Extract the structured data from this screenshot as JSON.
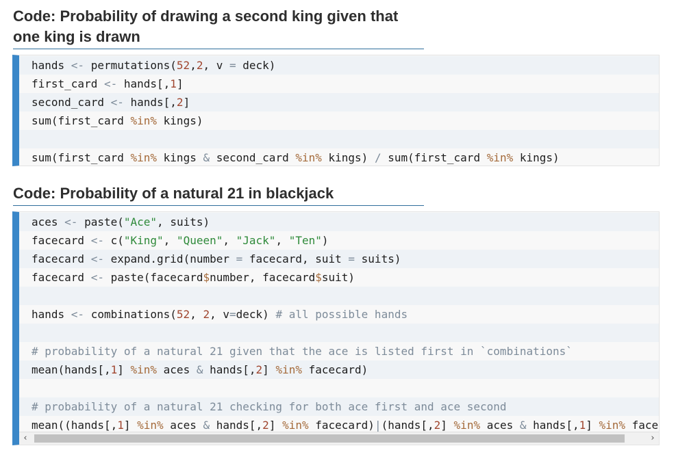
{
  "sections": [
    {
      "heading": "Code: Probability of drawing a second king given that one king is drawn",
      "lines": [
        [
          [
            "hands ",
            "plain"
          ],
          [
            "<-",
            "op"
          ],
          [
            " permutations(",
            "plain"
          ],
          [
            "52",
            "num"
          ],
          [
            ",",
            "plain"
          ],
          [
            "2",
            "num"
          ],
          [
            ", v ",
            "plain"
          ],
          [
            "=",
            "op"
          ],
          [
            " deck)",
            "plain"
          ]
        ],
        [
          [
            "first_card ",
            "plain"
          ],
          [
            "<-",
            "op"
          ],
          [
            " hands[,",
            "plain"
          ],
          [
            "1",
            "num"
          ],
          [
            "]",
            "plain"
          ]
        ],
        [
          [
            "second_card ",
            "plain"
          ],
          [
            "<-",
            "op"
          ],
          [
            " hands[,",
            "plain"
          ],
          [
            "2",
            "num"
          ],
          [
            "]",
            "plain"
          ]
        ],
        [
          [
            "sum(first_card ",
            "plain"
          ],
          [
            "%in%",
            "pct"
          ],
          [
            " kings)",
            "plain"
          ]
        ],
        [
          [
            "",
            "plain"
          ]
        ],
        [
          [
            "sum(first_card ",
            "plain"
          ],
          [
            "%in%",
            "pct"
          ],
          [
            " kings ",
            "plain"
          ],
          [
            "&",
            "op"
          ],
          [
            " second_card ",
            "plain"
          ],
          [
            "%in%",
            "pct"
          ],
          [
            " kings) ",
            "plain"
          ],
          [
            "/",
            "op"
          ],
          [
            " sum(first_card ",
            "plain"
          ],
          [
            "%in%",
            "pct"
          ],
          [
            " kings)",
            "plain"
          ]
        ]
      ]
    },
    {
      "heading": "Code: Probability of a natural 21 in blackjack",
      "lines": [
        [
          [
            "aces ",
            "plain"
          ],
          [
            "<-",
            "op"
          ],
          [
            " paste(",
            "plain"
          ],
          [
            "\"Ace\"",
            "str"
          ],
          [
            ", suits)",
            "plain"
          ]
        ],
        [
          [
            "facecard ",
            "plain"
          ],
          [
            "<-",
            "op"
          ],
          [
            " c(",
            "plain"
          ],
          [
            "\"King\"",
            "str"
          ],
          [
            ", ",
            "plain"
          ],
          [
            "\"Queen\"",
            "str"
          ],
          [
            ", ",
            "plain"
          ],
          [
            "\"Jack\"",
            "str"
          ],
          [
            ", ",
            "plain"
          ],
          [
            "\"Ten\"",
            "str"
          ],
          [
            ")",
            "plain"
          ]
        ],
        [
          [
            "facecard ",
            "plain"
          ],
          [
            "<-",
            "op"
          ],
          [
            " expand.grid(number ",
            "plain"
          ],
          [
            "=",
            "op"
          ],
          [
            " facecard, suit ",
            "plain"
          ],
          [
            "=",
            "op"
          ],
          [
            " suits)",
            "plain"
          ]
        ],
        [
          [
            "facecard ",
            "plain"
          ],
          [
            "<-",
            "op"
          ],
          [
            " paste(facecard",
            "plain"
          ],
          [
            "$",
            "pct"
          ],
          [
            "number, facecard",
            "plain"
          ],
          [
            "$",
            "pct"
          ],
          [
            "suit)",
            "plain"
          ]
        ],
        [
          [
            "",
            "plain"
          ]
        ],
        [
          [
            "hands ",
            "plain"
          ],
          [
            "<-",
            "op"
          ],
          [
            " combinations(",
            "plain"
          ],
          [
            "52",
            "num"
          ],
          [
            ", ",
            "plain"
          ],
          [
            "2",
            "num"
          ],
          [
            ", v",
            "plain"
          ],
          [
            "=",
            "op"
          ],
          [
            "deck) ",
            "plain"
          ],
          [
            "# all possible hands",
            "cmt"
          ]
        ],
        [
          [
            "",
            "plain"
          ]
        ],
        [
          [
            "# probability of a natural 21 given that the ace is listed first in `combinations`",
            "cmt"
          ]
        ],
        [
          [
            "mean(hands[,",
            "plain"
          ],
          [
            "1",
            "num"
          ],
          [
            "] ",
            "plain"
          ],
          [
            "%in%",
            "pct"
          ],
          [
            " aces ",
            "plain"
          ],
          [
            "&",
            "op"
          ],
          [
            " hands[,",
            "plain"
          ],
          [
            "2",
            "num"
          ],
          [
            "] ",
            "plain"
          ],
          [
            "%in%",
            "pct"
          ],
          [
            " facecard)",
            "plain"
          ]
        ],
        [
          [
            "",
            "plain"
          ]
        ],
        [
          [
            "# probability of a natural 21 checking for both ace first and ace second",
            "cmt"
          ]
        ],
        [
          [
            "mean((hands[,",
            "plain"
          ],
          [
            "1",
            "num"
          ],
          [
            "] ",
            "plain"
          ],
          [
            "%in%",
            "pct"
          ],
          [
            " aces ",
            "plain"
          ],
          [
            "&",
            "op"
          ],
          [
            " hands[,",
            "plain"
          ],
          [
            "2",
            "num"
          ],
          [
            "] ",
            "plain"
          ],
          [
            "%in%",
            "pct"
          ],
          [
            " facecard)",
            "plain"
          ],
          [
            "|",
            "op"
          ],
          [
            "(hands[,",
            "plain"
          ],
          [
            "2",
            "num"
          ],
          [
            "] ",
            "plain"
          ],
          [
            "%in%",
            "pct"
          ],
          [
            " aces ",
            "plain"
          ],
          [
            "&",
            "op"
          ],
          [
            " hands[,",
            "plain"
          ],
          [
            "1",
            "num"
          ],
          [
            "] ",
            "plain"
          ],
          [
            "%in%",
            "pct"
          ],
          [
            " facecard))",
            "plain"
          ]
        ]
      ],
      "scrollbar": {
        "left_icon": "scroll-left-arrow-icon",
        "right_icon": "scroll-right-arrow-icon",
        "left_glyph": "‹",
        "right_glyph": "›"
      }
    }
  ],
  "colors": {
    "accent_bar": "#3a87c8",
    "heading_rule": "#2f6e9c",
    "operator": "#7d8b99",
    "number": "#a0462f",
    "string": "#2f8a3a",
    "infix": "#a46a3a"
  }
}
